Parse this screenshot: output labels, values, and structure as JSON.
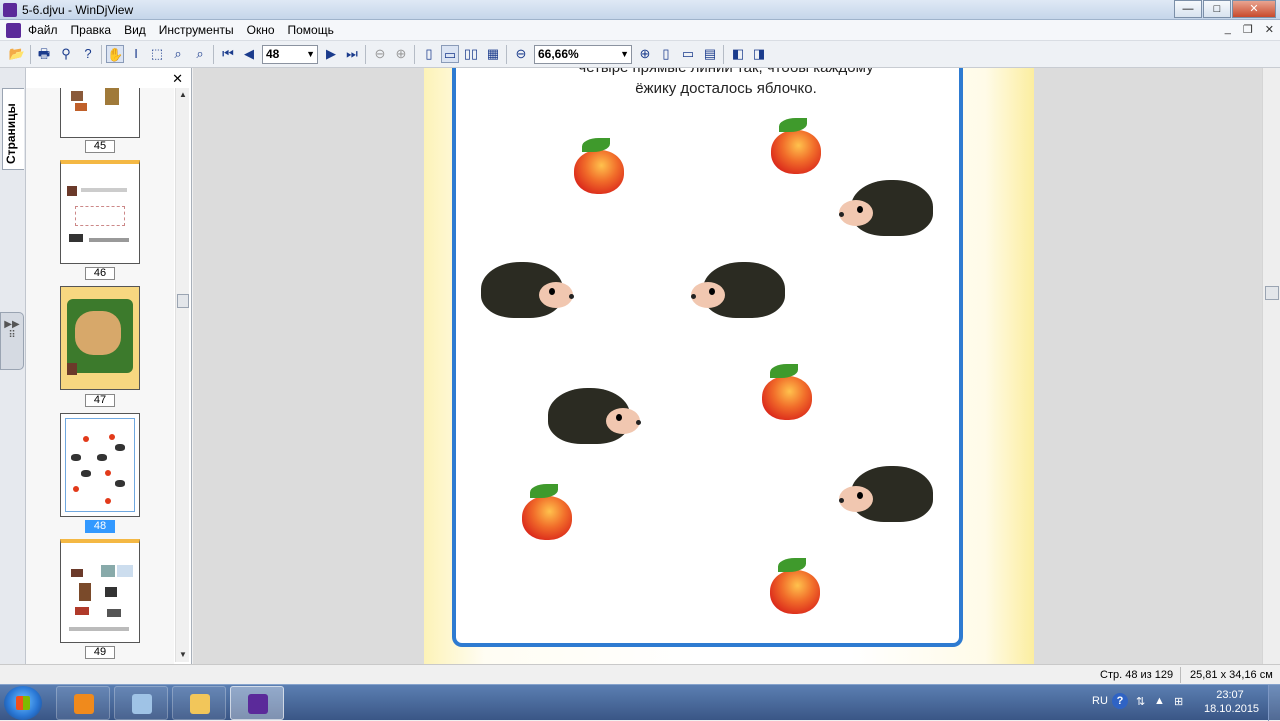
{
  "window": {
    "title": "5-6.djvu - WinDjView"
  },
  "menu": {
    "items": [
      "Файл",
      "Правка",
      "Вид",
      "Инструменты",
      "Окно",
      "Помощь"
    ]
  },
  "toolbar": {
    "page_value": "48",
    "zoom_value": "66,66%"
  },
  "sidebar": {
    "tab_label": "Страницы",
    "thumbnails": [
      {
        "page": "45",
        "selected": false
      },
      {
        "page": "46",
        "selected": false
      },
      {
        "page": "47",
        "selected": false
      },
      {
        "page": "48",
        "selected": true
      },
      {
        "page": "49",
        "selected": false
      }
    ]
  },
  "document": {
    "text_line1": "четыре прямые линии так, чтобы каждому",
    "text_line2": "ёжику досталось яблочко."
  },
  "status": {
    "page_info": "Стр. 48 из 129",
    "page_size": "25,81 x 34,16 см"
  },
  "taskbar": {
    "language": "RU",
    "time": "23:07",
    "date": "18.10.2015"
  },
  "colors": {
    "accent": "#3399ff",
    "frame": "#2e7bd1",
    "app_icon": "#5b2a9a"
  }
}
